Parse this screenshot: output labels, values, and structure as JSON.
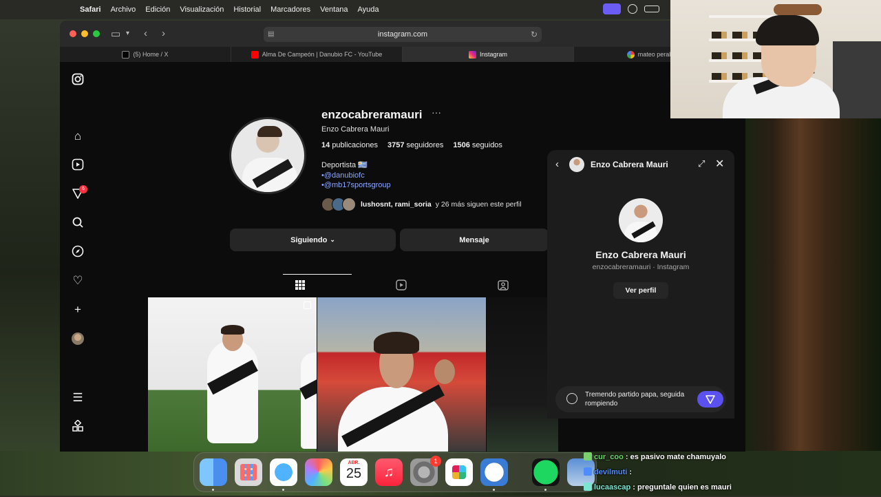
{
  "menubar": {
    "apple": "",
    "app": "Safari",
    "items": [
      "Archivo",
      "Edición",
      "Visualización",
      "Historial",
      "Marcadores",
      "Ventana",
      "Ayuda"
    ]
  },
  "browser": {
    "url": "instagram.com",
    "tabs": [
      {
        "label": "(5) Home / X",
        "icon": "x-logo-icon",
        "color": "#2a2a2a"
      },
      {
        "label": "Alma De Campeón | Danubio FC - YouTube",
        "icon": "youtube-icon",
        "color": "#ff0000"
      },
      {
        "label": "Instagram",
        "icon": "instagram-icon",
        "color": "#d6249f"
      },
      {
        "label": "mateo peralta - Bus",
        "icon": "google-icon",
        "color": "#4285f4"
      }
    ]
  },
  "instagram": {
    "nav_icons": [
      "instagram-logo-icon",
      "home-icon",
      "reels-icon",
      "messages-icon",
      "search-icon",
      "explore-icon",
      "heart-icon",
      "create-icon",
      "profile-avatar",
      "menu-icon",
      "threads-icon"
    ],
    "messages_badge": "6",
    "profile": {
      "username": "enzocabreramauri",
      "more": "···",
      "full_name": "Enzo Cabrera Mauri",
      "posts_count": "14",
      "posts_label": "publicaciones",
      "followers_count": "3757",
      "followers_label": "seguidores",
      "following_count": "1506",
      "following_label": "seguidos",
      "bio_title": "Deportista 🇺🇾",
      "bio_links": [
        "•@danubiofc",
        "•@mb17sportsgroup"
      ],
      "followed_by_names": "lushosnt, rami_soria",
      "followed_by_rest": "y 26 más siguen este perfil",
      "following_button": "Siguiendo",
      "message_button": "Mensaje"
    }
  },
  "dm": {
    "name": "Enzo Cabrera Mauri",
    "full_name": "Enzo Cabrera Mauri",
    "subtitle": "enzocabreramauri · Instagram",
    "view_profile": "Ver perfil",
    "draft": "Tremendo partido papa, seguida rompiendo"
  },
  "chat": [
    {
      "user": "cur_coo",
      "msg": ": es pasivo mate chamuyalo",
      "badge_color": "#7ad06f"
    },
    {
      "user": "devilmuti",
      "msg": ":",
      "badge_color": "#4f8cff"
    },
    {
      "user": "lucaascap",
      "msg": ": preguntale quien es mauri",
      "badge_color": "#7ae6d0"
    }
  ],
  "dock": {
    "calendar_month": "ABR.",
    "calendar_day": "25",
    "settings_badge": "1",
    "apps": [
      "finder-icon",
      "launchpad-icon",
      "safari-icon",
      "photos-icon",
      "calendar-icon",
      "music-icon",
      "settings-icon",
      "slack-icon",
      "tick-tick-icon",
      "spotify-icon",
      "preview-icon"
    ]
  }
}
